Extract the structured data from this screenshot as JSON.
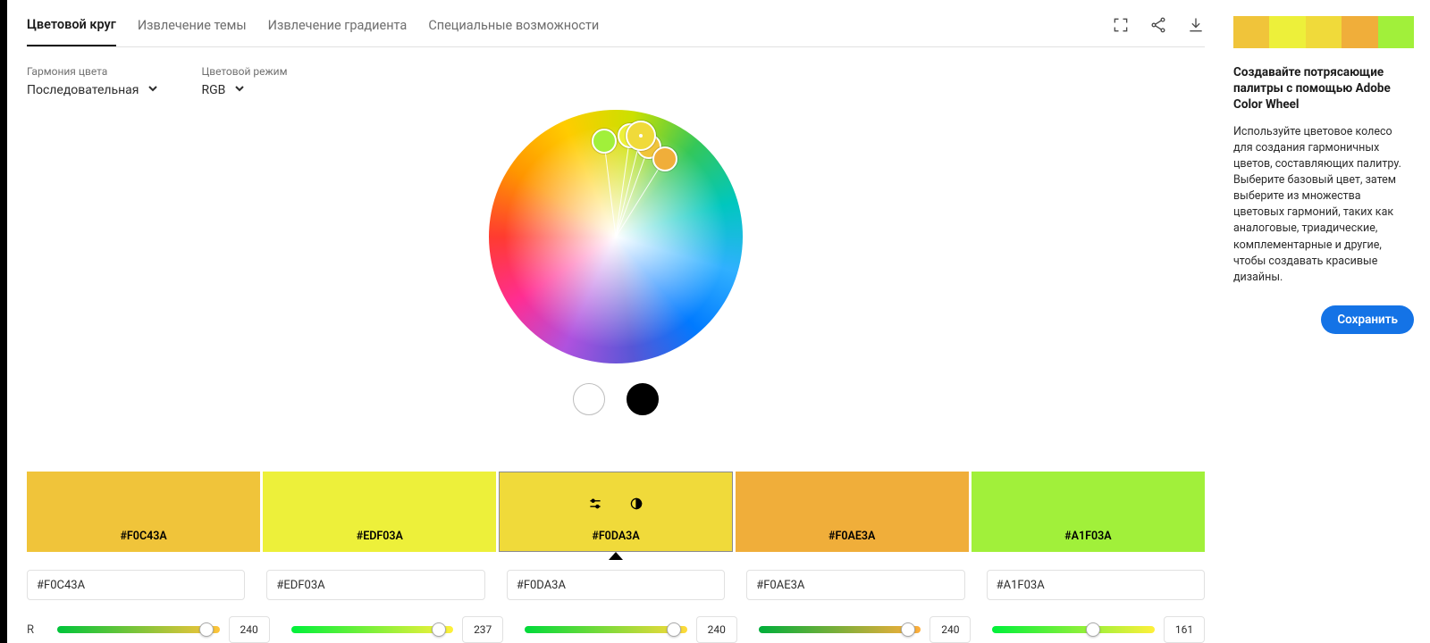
{
  "tabs": [
    "Цветовой круг",
    "Извлечение темы",
    "Извлечение градиента",
    "Специальные возможности"
  ],
  "active_tab": 0,
  "controls": {
    "harmony_label": "Гармония цвета",
    "harmony_value": "Последовательная",
    "mode_label": "Цветовой режим",
    "mode_value": "RGB"
  },
  "colors": [
    {
      "hex": "#F0C43A",
      "r": 240,
      "angle": 70,
      "radius": 107,
      "thumb": 92
    },
    {
      "hex": "#EDF03A",
      "r": 237,
      "angle": 82,
      "radius": 114,
      "thumb": 91
    },
    {
      "hex": "#F0DA3A",
      "r": 240,
      "angle": 76,
      "radius": 116,
      "thumb": 92,
      "base": true
    },
    {
      "hex": "#F0AE3A",
      "r": 240,
      "angle": 58,
      "radius": 103,
      "thumb": 92
    },
    {
      "hex": "#A1F03A",
      "r": 161,
      "angle": 97,
      "radius": 108,
      "thumb": 62
    }
  ],
  "selected_swatch": 2,
  "slider": {
    "label": "R",
    "max": 255
  },
  "sidebar": {
    "title": "Создавайте потрясающие палитры с помощью Adobe Color Wheel",
    "text": "Используйте цветовое колесо для создания гармоничных цветов, составляющих палитру. Выберите базовый цвет, затем выберите из множества цветовых гармоний, таких как аналоговые, триадические, комплементарные и другие, чтобы создавать красивые дизайны.",
    "save": "Сохранить"
  }
}
